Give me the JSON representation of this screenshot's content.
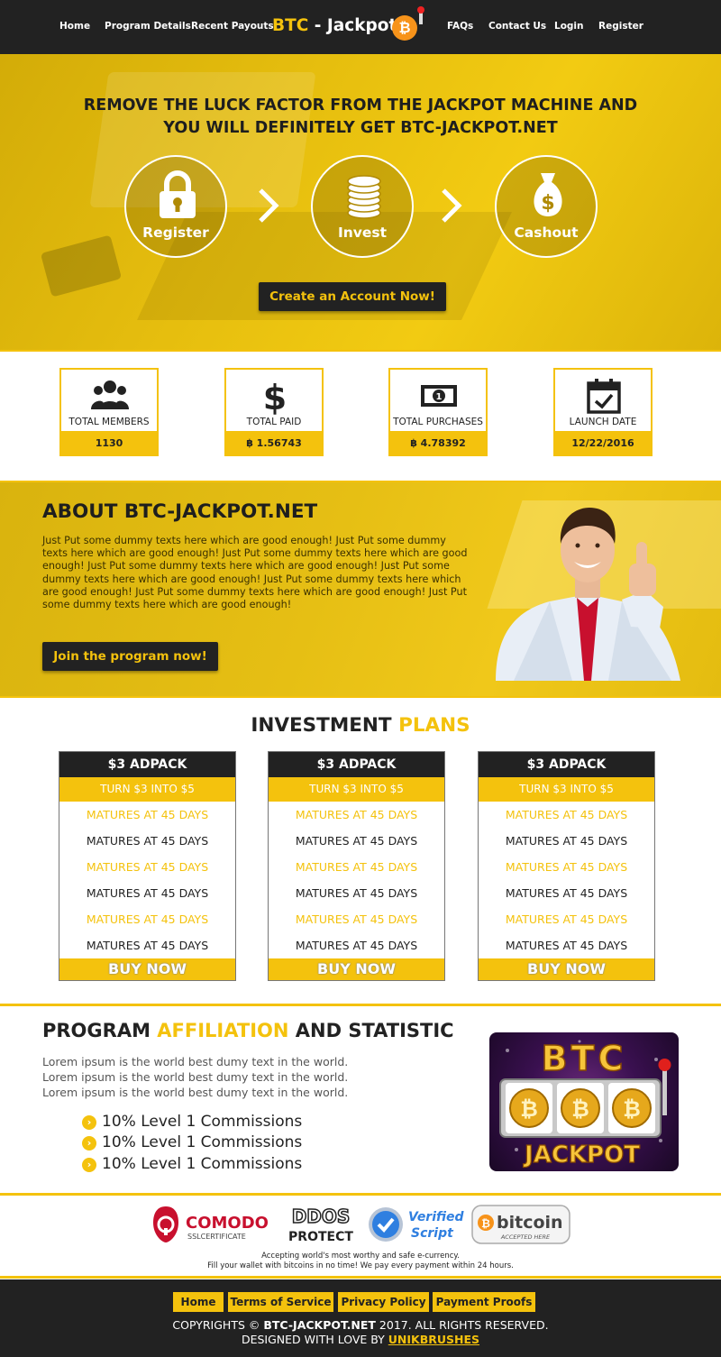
{
  "nav": {
    "links_left": [
      "Home",
      "Program Details",
      "Recent Payouts"
    ],
    "links_right": [
      "FAQs",
      "Contact Us",
      "Login",
      "Register"
    ],
    "logo": {
      "part1": "BTC",
      "dash": " - ",
      "part2": "Jackpot",
      "coin": "₿"
    }
  },
  "hero": {
    "title_line1": "REMOVE THE LUCK FACTOR FROM THE JACKPOT MACHINE AND",
    "title_line2": "YOU WILL DEFINITELY GET BTC-JACKPOT.NET",
    "steps": [
      "Register",
      "Invest",
      "Cashout"
    ],
    "cta": "Create an Account Now!"
  },
  "stats": [
    {
      "label": "TOTAL MEMBERS",
      "value": "1130",
      "icon": "members-icon"
    },
    {
      "label": "TOTAL PAID",
      "value": "฿ 1.56743",
      "icon": "dollar-icon"
    },
    {
      "label": "TOTAL PURCHASES",
      "value": "฿ 4.78392",
      "icon": "banknote-icon"
    },
    {
      "label": "LAUNCH DATE",
      "value": "12/22/2016",
      "icon": "calendar-icon"
    }
  ],
  "about": {
    "title": "ABOUT BTC-JACKPOT.NET",
    "text": "Just Put some dummy texts here which are good enough! Just Put some dummy texts here which are good enough! Just Put some dummy texts here which are good enough! Just Put some dummy texts here which are good enough! Just Put some dummy texts here which are good enough! Just Put some dummy texts here which are good enough! Just Put some dummy texts here which are good enough! Just Put some dummy texts here which are good enough!",
    "cta": "Join the program now!"
  },
  "plans": {
    "title_part1": "INVESTMENT ",
    "title_part2": "PLANS",
    "items": [
      {
        "name": "$3 ADPACK",
        "sub": "TURN $3 INTO $5",
        "rows": [
          "MATURES AT 45 DAYS",
          "MATURES AT 45 DAYS",
          "MATURES AT 45 DAYS",
          "MATURES AT 45 DAYS",
          "MATURES AT 45 DAYS",
          "MATURES AT 45 DAYS"
        ],
        "buy": "BUY NOW"
      },
      {
        "name": "$3 ADPACK",
        "sub": "TURN $3 INTO $5",
        "rows": [
          "MATURES AT 45 DAYS",
          "MATURES AT 45 DAYS",
          "MATURES AT 45 DAYS",
          "MATURES AT 45 DAYS",
          "MATURES AT 45 DAYS",
          "MATURES AT 45 DAYS"
        ],
        "buy": "BUY NOW"
      },
      {
        "name": "$3 ADPACK",
        "sub": "TURN $3 INTO $5",
        "rows": [
          "MATURES AT 45 DAYS",
          "MATURES AT 45 DAYS",
          "MATURES AT 45 DAYS",
          "MATURES AT 45 DAYS",
          "MATURES AT 45 DAYS",
          "MATURES AT 45 DAYS"
        ],
        "buy": "BUY NOW"
      }
    ]
  },
  "affiliation": {
    "title_part1": "PROGRAM ",
    "title_part2": "AFFILIATION",
    "title_part3": " AND STATISTIC",
    "lorem": [
      "Lorem ipsum is the world best dumy text in the world.",
      "Lorem ipsum is the world best dumy text in the world.",
      "Lorem ipsum is the world best dumy text in the world."
    ],
    "commissions": [
      "10% Level 1 Commissions",
      "10% Level 1 Commissions",
      "10% Level 1 Commissions"
    ],
    "slot": {
      "top": "BTC",
      "bottom": "JACKPOT",
      "coin": "₿"
    }
  },
  "badges": {
    "comodo": "COMODO",
    "comodo_sub": "SSLCERTIFICATE",
    "ddos1": "DDOS",
    "ddos2": "PROTECT",
    "verified1": "Verified",
    "verified2": "Script",
    "bitcoin": "bitcoin",
    "bitcoin_sub": "ACCEPTED HERE",
    "note1": "Accepting world's most worthy and safe e-currency.",
    "note2": "Fill your wallet with bitcoins in no time! We pay every payment within 24 hours."
  },
  "footer": {
    "links": [
      "Home",
      "Terms of Service",
      "Privacy Policy",
      "Payment Proofs"
    ],
    "copy_pre": "COPYRIGHTS © ",
    "copy_site": "BTC-JACKPOT.NET",
    "copy_post": " 2017. ALL RIGHTS RESERVED.",
    "designed_pre": "DESIGNED WITH LOVE BY ",
    "designed_by": "UNIKBRUSHES"
  },
  "colors": {
    "accent": "#f4c20d",
    "dark": "#222222",
    "bitcoin": "#f7931a"
  }
}
